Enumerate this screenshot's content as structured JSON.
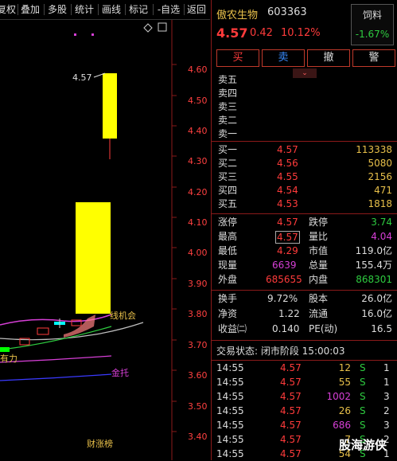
{
  "toolbar": {
    "buttons": [
      "复权",
      "叠加",
      "多股",
      "统计",
      "画线",
      "标记",
      "-自选",
      "返回"
    ]
  },
  "chart": {
    "price_labels": [
      "4.60",
      "4.50",
      "4.40",
      "4.30",
      "4.20",
      "4.10",
      "4.00",
      "3.90",
      "3.80",
      "3.70",
      "3.60",
      "3.50",
      "3.40"
    ],
    "high_marker": "4.57",
    "annotation_line": "线机会",
    "annotation_gold": "金托",
    "annotation_power": "有力",
    "bottom_tag": "财涨榜",
    "colors": {
      "up": "#ffff00",
      "price_axis": "#ff4040"
    }
  },
  "stock": {
    "name": "傲农生物",
    "code": "603363",
    "price": "4.57",
    "change": "0.42",
    "change_pct": "10.12%"
  },
  "sector": {
    "name": "饲料",
    "pct": "-1.67%"
  },
  "trade_buttons": [
    "买",
    "卖",
    "撤",
    "警"
  ],
  "order_book": {
    "sell_labels": [
      "卖五",
      "卖四",
      "卖三",
      "卖二",
      "卖一"
    ],
    "buy": [
      {
        "label": "买一",
        "price": "4.57",
        "volume": "113338"
      },
      {
        "label": "买二",
        "price": "4.56",
        "volume": "5080"
      },
      {
        "label": "买三",
        "price": "4.55",
        "volume": "2156"
      },
      {
        "label": "买四",
        "price": "4.54",
        "volume": "471"
      },
      {
        "label": "买五",
        "price": "4.53",
        "volume": "1818"
      }
    ]
  },
  "stats": {
    "limit_up_label": "涨停",
    "limit_up": "4.57",
    "limit_down_label": "跌停",
    "limit_down": "3.74",
    "high_label": "最高",
    "high": "4.57",
    "vol_ratio_label": "量比",
    "vol_ratio": "4.04",
    "low_label": "最低",
    "low": "4.29",
    "mcap_label": "市值",
    "mcap": "119.0亿",
    "cur_vol_label": "现量",
    "cur_vol": "6639",
    "total_vol_label": "总量",
    "total_vol": "155.4万",
    "outer_label": "外盘",
    "outer": "685655",
    "inner_label": "内盘",
    "inner": "868301",
    "turnover_label": "换手",
    "turnover": "9.72%",
    "equity_label": "股本",
    "equity": "26.0亿",
    "nav_label": "净资",
    "nav": "1.22",
    "float_label": "流通",
    "float": "16.0亿",
    "eps_label": "收益㈡",
    "eps": "0.140",
    "pe_label": "PE(动)",
    "pe": "16.5"
  },
  "status": "交易状态: 闭市阶段 15:00:03",
  "ticks": [
    {
      "time": "14:55",
      "price": "4.57",
      "vol": "12",
      "side": "S",
      "n": "1"
    },
    {
      "time": "14:55",
      "price": "4.57",
      "vol": "55",
      "side": "S",
      "n": "1"
    },
    {
      "time": "14:55",
      "price": "4.57",
      "vol": "1002",
      "side": "S",
      "n": "3"
    },
    {
      "time": "14:55",
      "price": "4.57",
      "vol": "26",
      "side": "S",
      "n": "2"
    },
    {
      "time": "14:55",
      "price": "4.57",
      "vol": "686",
      "side": "S",
      "n": "3"
    },
    {
      "time": "14:55",
      "price": "4.57",
      "vol": "7",
      "side": "S",
      "n": "2"
    },
    {
      "time": "14:55",
      "price": "4.57",
      "vol": "54",
      "side": "S",
      "n": "1"
    }
  ],
  "watermark": "股海游侠"
}
